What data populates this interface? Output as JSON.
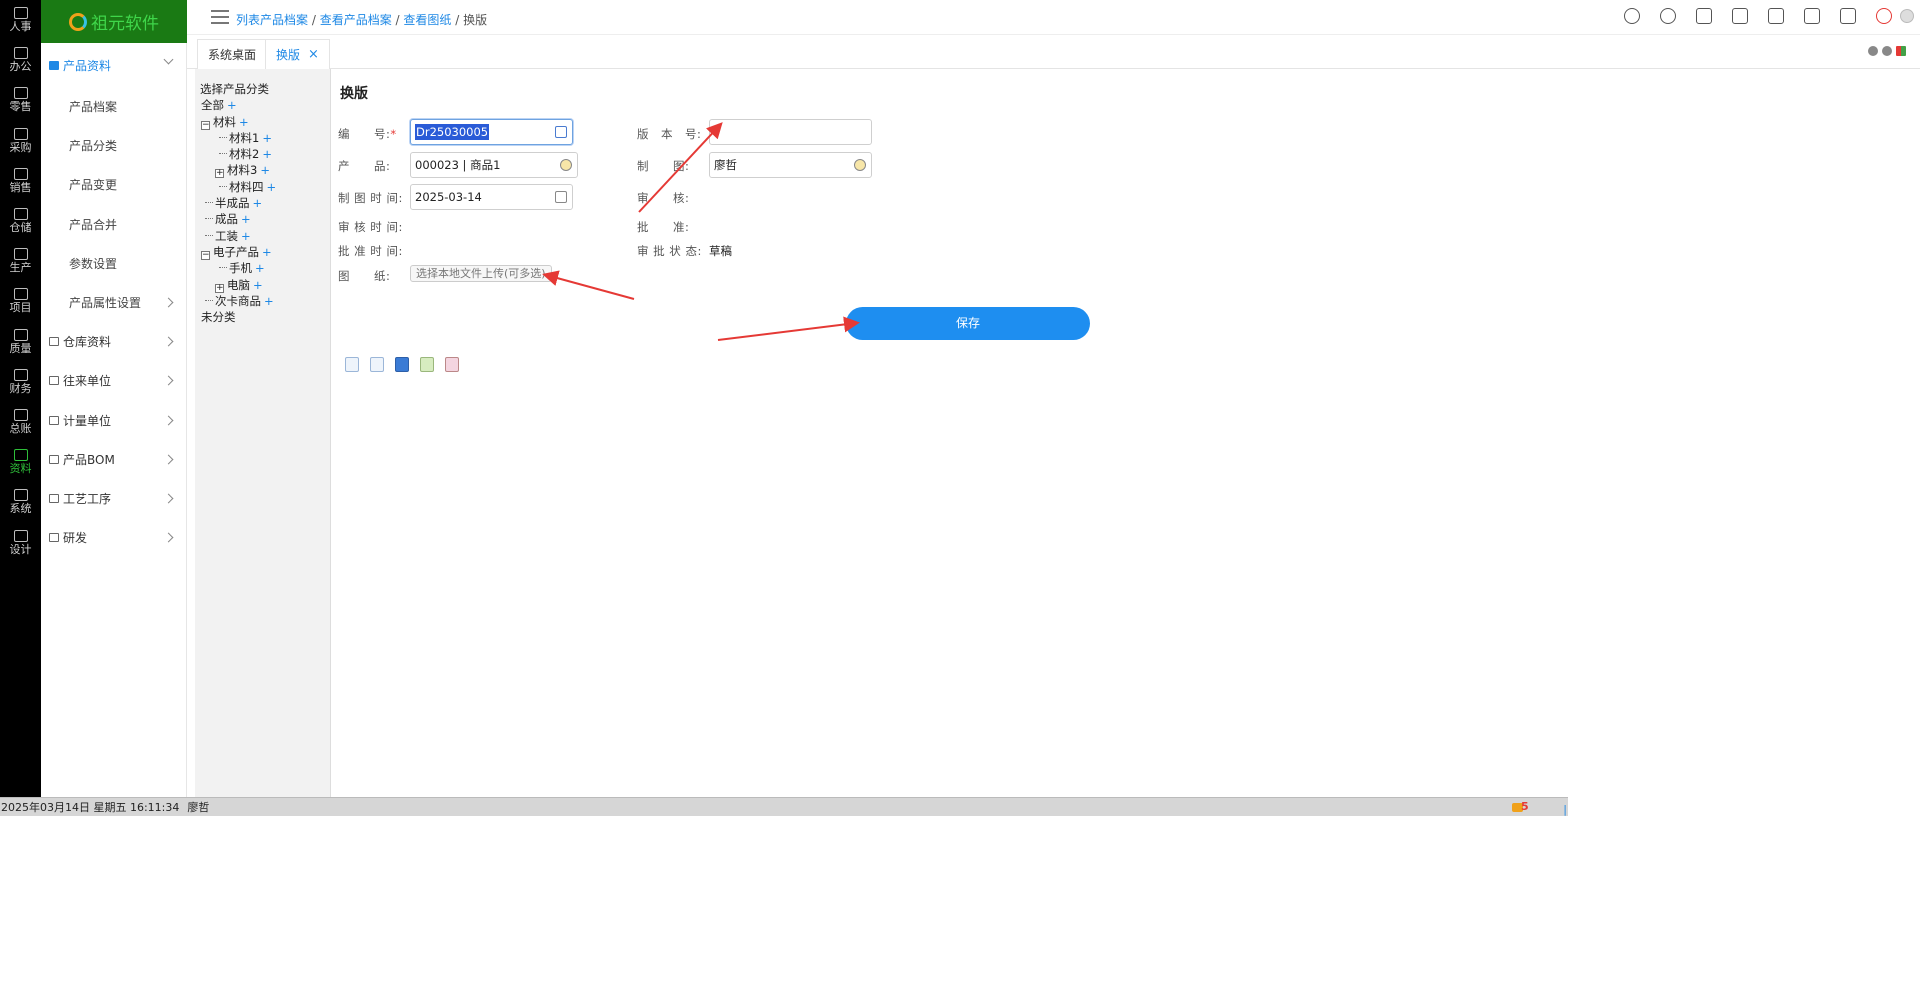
{
  "rail": [
    {
      "label": "人事",
      "icon": "people-icon"
    },
    {
      "label": "办公",
      "icon": "monitor-icon"
    },
    {
      "label": "零售",
      "icon": "store-icon"
    },
    {
      "label": "采购",
      "icon": "truck-icon"
    },
    {
      "label": "销售",
      "icon": "shop-icon"
    },
    {
      "label": "仓储",
      "icon": "warehouse-icon"
    },
    {
      "label": "生产",
      "icon": "fingerprint-icon"
    },
    {
      "label": "项目",
      "icon": "layers-icon"
    },
    {
      "label": "质量",
      "icon": "shield-icon"
    },
    {
      "label": "财务",
      "icon": "finance-icon"
    },
    {
      "label": "总账",
      "icon": "ledger-icon"
    },
    {
      "label": "资料",
      "icon": "document-icon"
    },
    {
      "label": "系统",
      "icon": "gear-icon"
    },
    {
      "label": "设计",
      "icon": "tools-icon"
    }
  ],
  "logo": {
    "text": "祖元软件"
  },
  "submenu": {
    "group_product": "产品资料",
    "items": [
      "产品档案",
      "产品分类",
      "产品变更",
      "产品合并",
      "参数设置",
      "产品属性设置"
    ],
    "groups": [
      "仓库资料",
      "往来单位",
      "计量单位",
      "产品BOM",
      "工艺工序",
      "研发"
    ]
  },
  "breadcrumb": {
    "c1": "列表产品档案",
    "c2": "查看产品档案",
    "c3": "查看图纸",
    "current": "换版",
    "sep": " / "
  },
  "tabs": {
    "desk": "系统桌面",
    "active": "换版",
    "close": "×"
  },
  "tree": {
    "title": "选择产品分类",
    "plus": "+",
    "nodes": [
      "全部",
      "材料",
      "材料1",
      "材料2",
      "材料3",
      "材料四",
      "半成品",
      "成品",
      "工装",
      "电子产品",
      "手机",
      "电脑",
      "次卡商品",
      "未分类"
    ]
  },
  "form": {
    "title": "换版",
    "code_label": "编　　号:",
    "code_required": "*",
    "code_value": "Dr25030005",
    "version_label": "版　本　号:",
    "version_value": "",
    "product_label": "产　　品:",
    "product_value": "000023 | 商品1",
    "maker_label": "制　　图:",
    "maker_value": "廖哲",
    "draw_time_label": "制 图 时 间:",
    "draw_time_value": "2025-03-14",
    "auditor_label": "审　　核:",
    "audit_time_label": "审 核 时 间:",
    "approver_label": "批　　准:",
    "approve_time_label": "批 准 时 间:",
    "approve_status_label": "审 批 状 态:",
    "approve_status_value": "草稿",
    "drawing_label": "图　　纸:",
    "upload_label": "选择本地文件上传(可多选)",
    "save_label": "保存"
  },
  "statusbar": {
    "datetime": "2025年03月14日 星期五 16:11:34",
    "user": "廖哲",
    "msg_count": "5"
  },
  "colors": {
    "accent": "#1e88e5",
    "rail": "#000000",
    "logo_bg": "#1a7a14",
    "arrow": "#e53935",
    "save": "#1e8ef0"
  }
}
